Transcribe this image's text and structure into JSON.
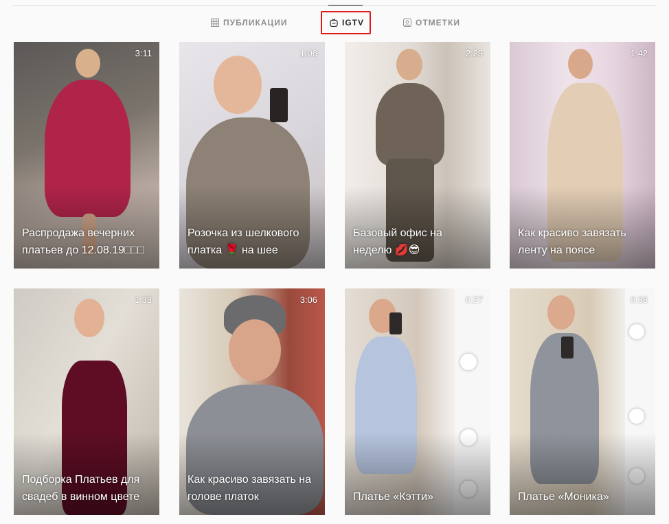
{
  "tabs": [
    {
      "label": "ПУБЛИКАЦИИ",
      "icon": "grid-icon",
      "active": false
    },
    {
      "label": "IGTV",
      "icon": "igtv-icon",
      "active": true
    },
    {
      "label": "ОТМЕТКИ",
      "icon": "tagged-icon",
      "active": false
    }
  ],
  "videos": [
    {
      "duration": "3:11",
      "title": "Распродажа вечерних платьев до 12.08.19□□□"
    },
    {
      "duration": "1:06",
      "title": "Розочка из шелкового платка 🌹 на шее"
    },
    {
      "duration": "2:29",
      "title": "Базовый офис на неделю 💋😎"
    },
    {
      "duration": "1:42",
      "title": "Как красиво завязать ленту на поясе"
    },
    {
      "duration": "1:33",
      "title": "Подборка Платьев для свадеб в винном цвете"
    },
    {
      "duration": "3:06",
      "title": "Как красиво завязать на голове платок"
    },
    {
      "duration": "0:27",
      "title": "Платье «Кэтти»"
    },
    {
      "duration": "0:38",
      "title": "Платье «Моника»"
    }
  ],
  "colors": {
    "highlight": "#e0191b",
    "active_tab": "#262626",
    "inactive_tab": "#8e8e8e"
  }
}
